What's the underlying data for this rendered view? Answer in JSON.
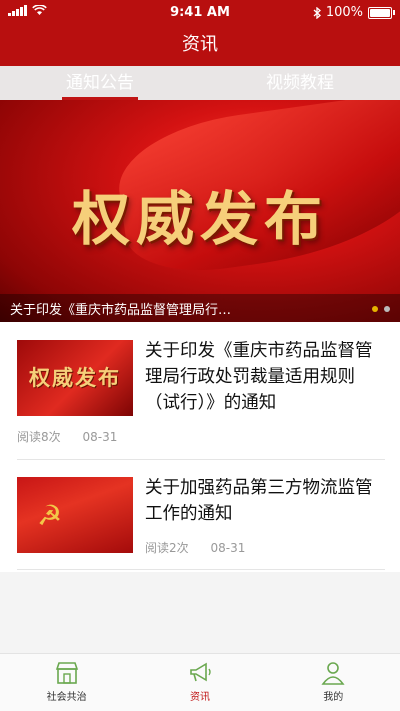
{
  "status_bar": {
    "time": "9:41 AM",
    "battery": "100%"
  },
  "header": {
    "title": "资讯"
  },
  "tabs": [
    {
      "label": "通知公告",
      "active": true
    },
    {
      "label": "视频教程",
      "active": false
    }
  ],
  "banner": {
    "image_text": "权威发布",
    "caption": "关于印发《重庆市药品监督管理局行…",
    "slide_count": 2,
    "current_slide": 1
  },
  "articles": [
    {
      "thumb_text": "权威发布",
      "title": "关于印发《重庆市药品监督管理局行政处罚裁量适用规则（试行）》的通知",
      "reads": "阅读8次",
      "date": "08-31"
    },
    {
      "thumb_text": "",
      "title": "关于加强药品第三方物流监管工作的通知",
      "reads": "阅读2次",
      "date": "08-31"
    }
  ],
  "tabbar": [
    {
      "label": "社会共治",
      "icon": "storefront-icon",
      "active": false
    },
    {
      "label": "资讯",
      "icon": "megaphone-icon",
      "active": true
    },
    {
      "label": "我的",
      "icon": "person-icon",
      "active": false
    }
  ],
  "colors": {
    "brand": "#b80f0f",
    "accent_gold": "#f6cf7a",
    "active_tab": "#c01414"
  }
}
